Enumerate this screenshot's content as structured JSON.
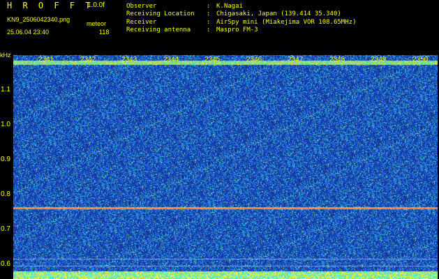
{
  "header": {
    "title": "H R O F F T",
    "version": "1.0.0f",
    "filename": "KN9_2506042340.png",
    "datetime": "25.06.04 23:40",
    "mode_label": "meteor",
    "count": "118"
  },
  "meta": [
    {
      "key": "Observer",
      "value": "K.Nagai"
    },
    {
      "key": "Receiving Location",
      "value": "Chigasaki, Japan (139.414 35.340)"
    },
    {
      "key": "Receiver",
      "value": "AirSpy mini (Miakejima VOR 108.65MHz)"
    },
    {
      "key": "Receiving antenna",
      "value": "Maspro FM-3"
    }
  ],
  "spectrogram": {
    "y_unit": "kHz",
    "y_ticks": [
      "1.1",
      "1.0",
      "0.9",
      "0.8",
      "0.7",
      "0.6"
    ],
    "x_ticks": [
      "2341",
      "2342",
      "2343",
      "2344",
      "2345",
      "2346",
      "2347",
      "2348",
      "2349",
      "2350"
    ],
    "y_range_khz": [
      0.58,
      1.17
    ],
    "carrier_line_khz": 0.76,
    "colors": {
      "background": "#1e3a9a",
      "line": "#ff3c3c",
      "tick_text": "#ffff00"
    }
  }
}
